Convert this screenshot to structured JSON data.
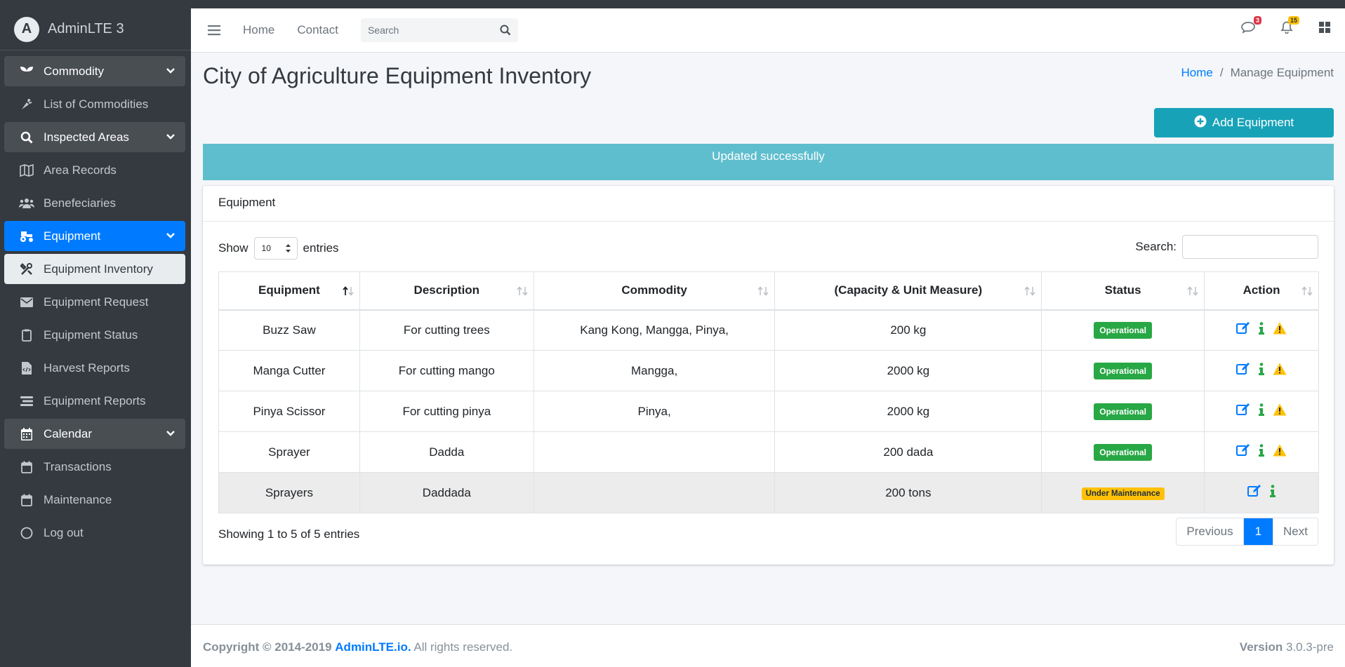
{
  "brand": {
    "name": "AdminLTE 3",
    "logo_letter": "A"
  },
  "sidebar": {
    "items": [
      {
        "label": "Commodity",
        "icon": "seedling-icon",
        "type": "header"
      },
      {
        "label": "List of Commodities",
        "icon": "carrot-icon",
        "type": "link"
      },
      {
        "label": "Inspected Areas",
        "icon": "search-icon",
        "type": "header"
      },
      {
        "label": "Area Records",
        "icon": "map-icon",
        "type": "link"
      },
      {
        "label": "Benefeciaries",
        "icon": "users-icon",
        "type": "link"
      },
      {
        "label": "Equipment",
        "icon": "tractor-icon",
        "type": "active"
      },
      {
        "label": "Equipment Inventory",
        "icon": "tools-icon",
        "type": "selected"
      },
      {
        "label": "Equipment Request",
        "icon": "envelope-icon",
        "type": "link"
      },
      {
        "label": "Equipment Status",
        "icon": "clipboard-icon",
        "type": "link"
      },
      {
        "label": "Harvest Reports",
        "icon": "file-code-icon",
        "type": "link"
      },
      {
        "label": "Equipment Reports",
        "icon": "list-icon",
        "type": "link"
      },
      {
        "label": "Calendar",
        "icon": "calendar-icon",
        "type": "header"
      },
      {
        "label": "Transactions",
        "icon": "calendar-outline-icon",
        "type": "link"
      },
      {
        "label": "Maintenance",
        "icon": "calendar-outline-icon",
        "type": "link"
      },
      {
        "label": "Log out",
        "icon": "circle-icon",
        "type": "link"
      }
    ]
  },
  "topbar": {
    "home": "Home",
    "contact": "Contact",
    "search_placeholder": "Search",
    "messages_count": "3",
    "notifications_count": "15"
  },
  "page": {
    "title": "City of Agriculture Equipment Inventory",
    "breadcrumb_home": "Home",
    "breadcrumb_current": "Manage Equipment",
    "add_button": "Add Equipment",
    "alert": "Updated successfully"
  },
  "card": {
    "title": "Equipment",
    "show_label": "Show",
    "entries_value": "10",
    "entries_label": "entries",
    "search_label": "Search:",
    "columns": [
      "Equipment",
      "Description",
      "Commodity",
      "(Capacity & Unit Measure)",
      "Status",
      "Action"
    ],
    "rows": [
      {
        "equipment": "Buzz Saw",
        "description": "For cutting trees",
        "commodity": "Kang Kong, Mangga, Pinya,",
        "capacity": "200 kg",
        "status": "Operational",
        "status_color": "#28a745"
      },
      {
        "equipment": "Manga Cutter",
        "description": "For cutting mango",
        "commodity": "Mangga,",
        "capacity": "2000 kg",
        "status": "Operational",
        "status_color": "#28a745"
      },
      {
        "equipment": "Pinya Scissor",
        "description": "For cutting pinya",
        "commodity": "Pinya,",
        "capacity": "2000 kg",
        "status": "Operational",
        "status_color": "#28a745"
      },
      {
        "equipment": "Sprayer",
        "description": "Dadda",
        "commodity": "",
        "capacity": "200 dada",
        "status": "Operational",
        "status_color": "#28a745"
      },
      {
        "equipment": "Sprayers",
        "description": "Daddada",
        "commodity": "",
        "capacity": "200 tons",
        "status": "Under Maintenance",
        "status_color": "#ffc107"
      }
    ],
    "info": "Showing 1 to 5 of 5 entries",
    "pager": {
      "previous": "Previous",
      "current": "1",
      "next": "Next"
    }
  },
  "footer": {
    "copyright": "Copyright © 2014-2019",
    "link": "AdminLTE.io.",
    "rights": "All rights reserved.",
    "version_label": "Version",
    "version": "3.0.3-pre"
  },
  "colors": {
    "primary": "#007bff",
    "info": "#17a2b8",
    "success": "#28a745",
    "warning": "#ffc107",
    "sidebar": "#343a40"
  }
}
